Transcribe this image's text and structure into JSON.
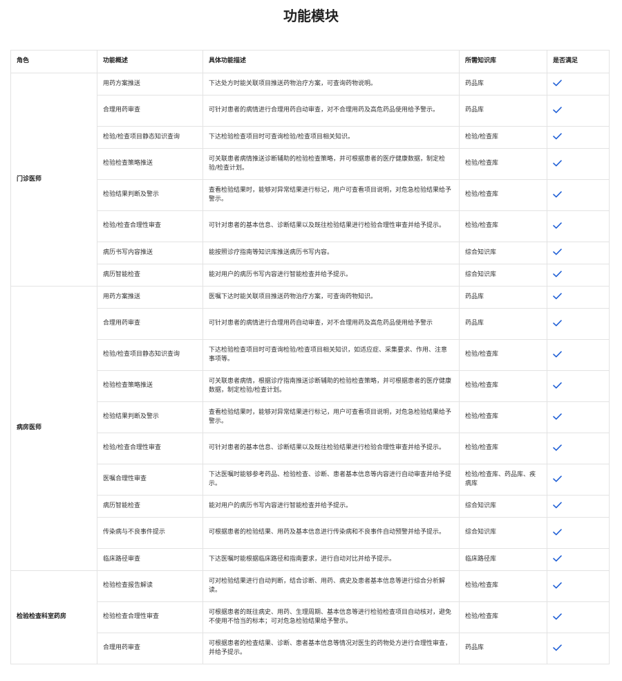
{
  "title": "功能模块",
  "headers": {
    "role": "角色",
    "overview": "功能概述",
    "detail": "具体功能描述",
    "kb": "所需知识库",
    "satisfied": "是否满足"
  },
  "colors": {
    "check": "#1f5fd6",
    "border": "#e3e3e3"
  },
  "icons": {
    "satisfied": "checkmark-icon"
  },
  "groups": [
    {
      "role": "门诊医师",
      "rows": [
        {
          "overview": "用药方案推送",
          "detail": "下达处方时能关联项目推送药物治疗方案，可查询药物说明。",
          "kb": "药品库",
          "satisfied": true
        },
        {
          "overview": "合理用药审查",
          "detail": "可针对患者的病情进行合理用药自动审查，对不合理用药及高危药品使用给予警示。",
          "kb": "药品库",
          "satisfied": true
        },
        {
          "overview": "检验/检查项目静态知识查询",
          "detail": "下达检验检查项目时可查询检验/检查项目相关知识。",
          "kb": "检验/检查库",
          "satisfied": true
        },
        {
          "overview": "检验检查策略推送",
          "detail": "可关联患者病情推送诊断辅助的检验检查策略，并可根据患者的医疗健康数据，制定检验/检查计划。",
          "kb": "检验/检查库",
          "satisfied": true
        },
        {
          "overview": "检验结果判断及警示",
          "detail": "查看检验结果时，能够对异常结果进行标记，用户可查看项目说明，对危急检验结果给予警示。",
          "kb": "检验/检查库",
          "satisfied": true
        },
        {
          "overview": "检验/检查合理性审查",
          "detail": "可针对患者的基本信息、诊断结果以及既往检验结果进行检验合理性审查并给予提示。",
          "kb": "检验/检查库",
          "satisfied": true
        },
        {
          "overview": "病历书写内容推送",
          "detail": "能按照诊疗指南等知识库推送病历书写内容。",
          "kb": "综合知识库",
          "satisfied": true
        },
        {
          "overview": "病历智能检查",
          "detail": "能对用户的病历书写内容进行智能检查并给予提示。",
          "kb": "综合知识库",
          "satisfied": true
        }
      ]
    },
    {
      "role": "病房医师",
      "rows": [
        {
          "overview": "用药方案推送",
          "detail": "医嘱下达时能关联项目推送药物治疗方案，可查询药物知识。",
          "kb": "药品库",
          "satisfied": true
        },
        {
          "overview": "合理用药审查",
          "detail": "可针对患者的病情进行合理用药自动审查，对不合理用药及高危药品使用给予警示",
          "kb": "药品库",
          "satisfied": true
        },
        {
          "overview": "检验/检查项目静态知识查询",
          "detail": "下达检验检查项目时可查询检验/检查项目相关知识，如适应症、采集要求、作用、注意事项等。",
          "kb": "检验/检查库",
          "satisfied": true
        },
        {
          "overview": "检验检查策略推送",
          "detail": "可关联患者病情，根据诊疗指南推送诊断辅助的检验检查策略，并可根据患者的医疗健康数据，制定检验/检查计划。",
          "kb": "检验/检查库",
          "satisfied": true
        },
        {
          "overview": "检验结果判断及警示",
          "detail": "查看检验结果时，能够对异常结果进行标记，用户可查看项目说明，对危急检验结果给予警示。",
          "kb": "检验/检查库",
          "satisfied": true
        },
        {
          "overview": "检验/检查合理性审查",
          "detail": "可针对患者的基本信息、诊断结果以及既往检验结果进行检验合理性审查并给予提示。",
          "kb": "检验/检查库",
          "satisfied": true
        },
        {
          "overview": "医嘱合理性审查",
          "detail": "下达医嘱时能够参考药品、检验检查、诊断、患者基本信息等内容进行自动审查并给予提示。",
          "kb": "检验/检查库、药品库、疾病库",
          "satisfied": true
        },
        {
          "overview": "病历智能检查",
          "detail": "能对用户的病历书写内容进行智能检查并给予提示。",
          "kb": "综合知识库",
          "satisfied": true
        },
        {
          "overview": "传染病与不良事件提示",
          "detail": "可根据患者的检验结果、用药及基本信息进行传染病和不良事件自动预警并给予提示。",
          "kb": "综合知识库",
          "satisfied": true
        },
        {
          "overview": "临床路径审查",
          "detail": "下达医嘱时能根据临床路径和指南要求，进行自动对比并给予提示。",
          "kb": "临床路径库",
          "satisfied": true
        }
      ]
    },
    {
      "role": "检验检查科室药房",
      "rows": [
        {
          "overview": "检验检查报告解读",
          "detail": "可对检验结果进行自动判断，结合诊断、用药、病史及患者基本信息等进行综合分析解读。",
          "kb": "检验/检查库",
          "satisfied": true
        },
        {
          "overview": "检验检查合理性审查",
          "detail": "可根据患者的既往病史、用药、生理周期、基本信息等进行检验检查项目自动核对，避免不使用不恰当的标本；可对危急检验结果给予警示。",
          "kb": "检验/检查库",
          "satisfied": true
        },
        {
          "overview": "合理用药审查",
          "detail": "可根据患者的检查结果、诊断、患者基本信息等情况对医生的药物处方进行合理性审查，并给予提示。",
          "kb": "药品库",
          "satisfied": true
        }
      ]
    }
  ]
}
